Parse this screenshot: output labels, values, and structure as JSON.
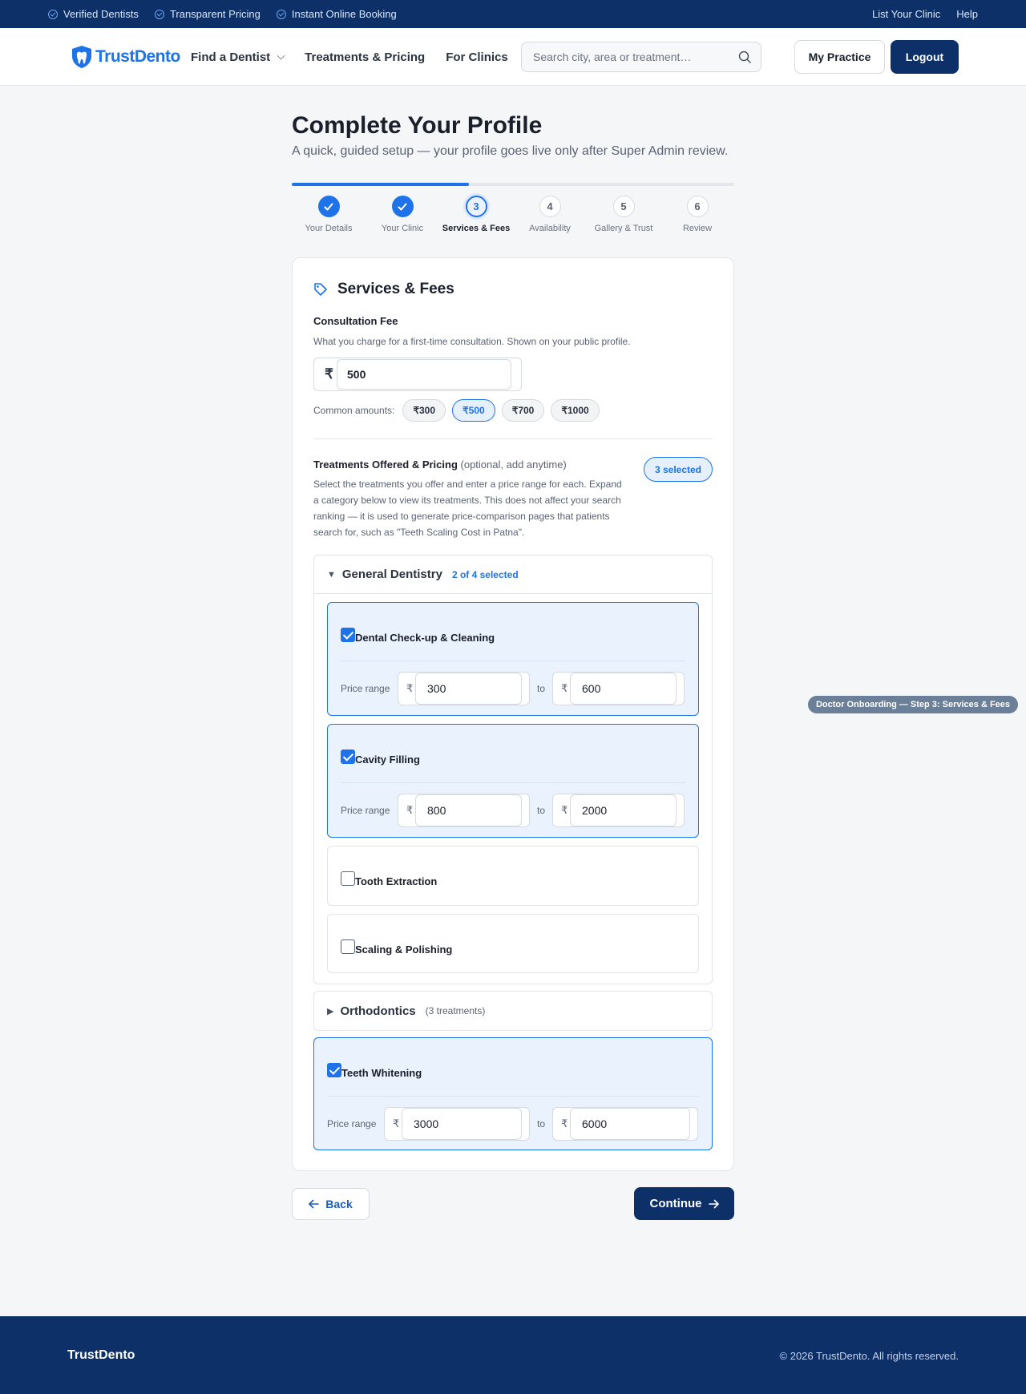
{
  "topbar": {
    "badges": [
      "Verified Dentists",
      "Transparent Pricing",
      "Instant Online Booking"
    ],
    "links": [
      "List Your Clinic",
      "Help"
    ]
  },
  "header": {
    "logo_text": "TrustDento",
    "nav": [
      "Find a Dentist",
      "Treatments & Pricing",
      "For Clinics"
    ],
    "search_placeholder": "Search city, area or treatment…",
    "my_practice": "My Practice",
    "logout": "Logout"
  },
  "page": {
    "title": "Complete Your Profile",
    "subtitle": "A quick, guided setup — your profile goes live only after Super Admin review."
  },
  "progress": {
    "fraction": 0.4
  },
  "steps": [
    {
      "num": "1",
      "label": "Your Details",
      "state": "done"
    },
    {
      "num": "2",
      "label": "Your Clinic",
      "state": "done"
    },
    {
      "num": "3",
      "label": "Services & Fees",
      "state": "current"
    },
    {
      "num": "4",
      "label": "Availability",
      "state": "todo"
    },
    {
      "num": "5",
      "label": "Gallery & Trust",
      "state": "todo"
    },
    {
      "num": "6",
      "label": "Review",
      "state": "todo"
    }
  ],
  "card": {
    "title": "Services & Fees",
    "consultation": {
      "label": "Consultation Fee",
      "hint": "What you charge for a first-time consultation. Shown on your public profile.",
      "currency": "₹",
      "value": "500",
      "common_label": "Common amounts:",
      "common_amounts": [
        "₹300",
        "₹500",
        "₹700",
        "₹1000"
      ],
      "active_amount": "₹500"
    },
    "treatments": {
      "label": "Treatments Offered & Pricing",
      "optional": "(optional, add anytime)",
      "hint": "Select the treatments you offer and enter a price range for each. Expand a category below to view its treatments. This does not affect your search ranking — it is used to generate price-comparison pages that patients search for, such as \"Teeth Scaling Cost in Patna\".",
      "selected_badge": "3 selected",
      "price_range_label": "Price range",
      "to_label": "to",
      "currency": "₹",
      "categories": [
        {
          "name": "General Dentistry",
          "count": "2 of 4 selected",
          "expanded": true,
          "items": [
            {
              "name": "Dental Check-up & Cleaning",
              "checked": true,
              "min": "300",
              "max": "600"
            },
            {
              "name": "Cavity Filling",
              "checked": true,
              "min": "800",
              "max": "2000"
            },
            {
              "name": "Tooth Extraction",
              "checked": false
            },
            {
              "name": "Scaling & Polishing",
              "checked": false
            }
          ]
        },
        {
          "name": "Orthodontics",
          "count": "(3 treatments)",
          "expanded": false
        }
      ],
      "extra_item": {
        "name": "Teeth Whitening",
        "checked": true,
        "min": "3000",
        "max": "6000"
      }
    }
  },
  "actions": {
    "back": "Back",
    "continue": "Continue"
  },
  "side_tag": "Doctor Onboarding — Step 3: Services & Fees",
  "footer": {
    "brand": "TrustDento",
    "copyright": "© 2026 TrustDento. All rights reserved."
  },
  "colors": {
    "navy": "#0d3068",
    "accent": "#1e73e8"
  }
}
